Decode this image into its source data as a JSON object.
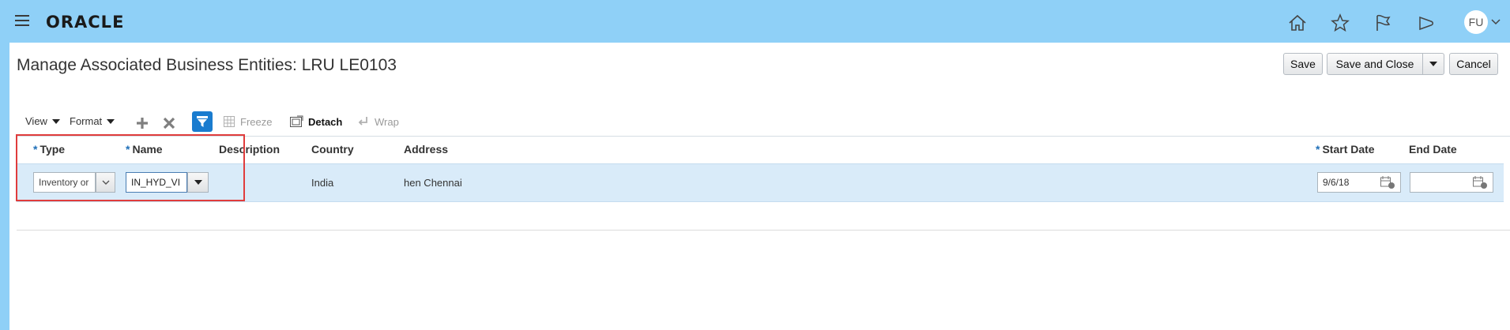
{
  "header": {
    "brand": "ORACLE",
    "avatar_initials": "FU",
    "icons": [
      "home-icon",
      "favorites-star-icon",
      "notifications-flag-icon",
      "watchlist-icon"
    ]
  },
  "page": {
    "title": "Manage Associated Business Entities: LRU LE0103"
  },
  "actions": {
    "save": "Save",
    "save_and_close": "Save and Close",
    "cancel": "Cancel"
  },
  "toolbar": {
    "view": "View",
    "format": "Format",
    "freeze": "Freeze",
    "detach": "Detach",
    "wrap": "Wrap"
  },
  "table": {
    "columns": {
      "type": "Type",
      "name": "Name",
      "description": "Description",
      "country": "Country",
      "address": "Address",
      "start_date": "Start Date",
      "end_date": "End Date"
    },
    "required_marker": "*",
    "row": {
      "type_value": "Inventory or",
      "name_value": "IN_HYD_VI",
      "description": "",
      "country": "India",
      "address": "hen Chennai",
      "start_date": "9/6/18",
      "end_date": ""
    }
  },
  "colors": {
    "header_bg": "#8fd0f7",
    "selected_row_bg": "#d9ebf9",
    "required_marker": "#1f6fb8",
    "highlight_box": "#e03c3c",
    "detach_active": "#1a7ccf"
  }
}
